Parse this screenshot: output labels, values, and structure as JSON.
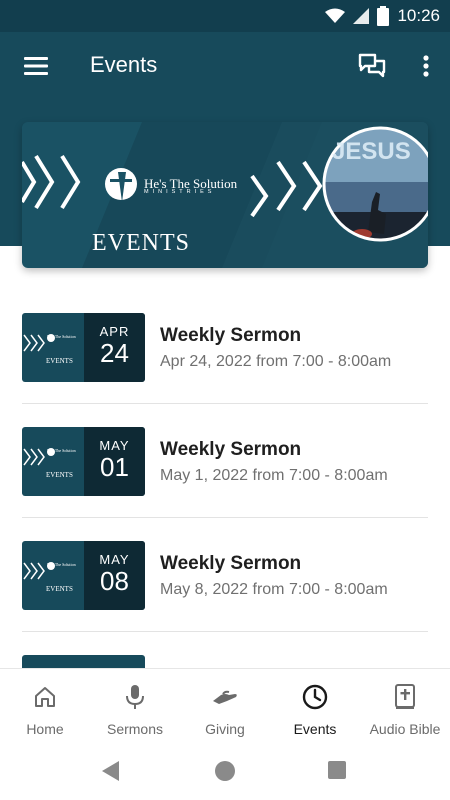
{
  "status": {
    "time": "10:26"
  },
  "header": {
    "title": "Events"
  },
  "banner": {
    "heading": "EVENTS",
    "logo_main": "He's The Solution",
    "logo_sub": "MINISTRIES",
    "image_word": "JESUS"
  },
  "events": [
    {
      "month": "APR",
      "day": "24",
      "title": "Weekly Sermon",
      "time": "Apr 24, 2022 from 7:00 - 8:00am"
    },
    {
      "month": "MAY",
      "day": "01",
      "title": "Weekly Sermon",
      "time": "May 1, 2022 from 7:00 - 8:00am"
    },
    {
      "month": "MAY",
      "day": "08",
      "title": "Weekly Sermon",
      "time": "May 8, 2022 from 7:00 - 8:00am"
    }
  ],
  "nav": [
    {
      "label": "Home",
      "icon": "home-icon"
    },
    {
      "label": "Sermons",
      "icon": "microphone-icon"
    },
    {
      "label": "Giving",
      "icon": "giving-hand-icon"
    },
    {
      "label": "Events",
      "icon": "clock-icon",
      "active": true
    },
    {
      "label": "Audio Bible",
      "icon": "bible-icon"
    }
  ],
  "colors": {
    "primary": "#174a5b",
    "status_bar": "#123e4e",
    "active_nav": "#1a1a1a",
    "inactive_nav": "#6b6b6b"
  }
}
